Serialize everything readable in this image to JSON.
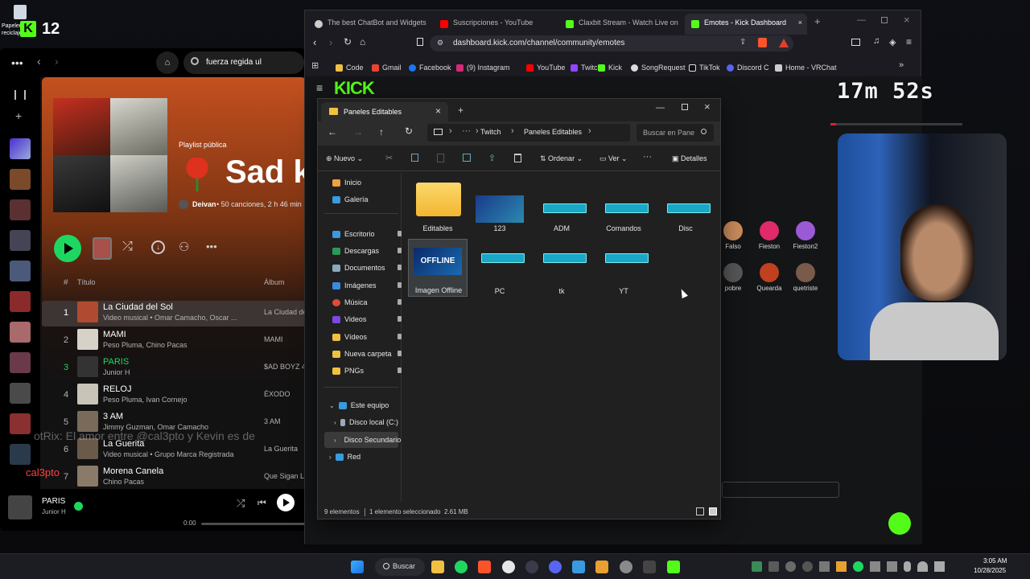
{
  "desktop": {
    "recycle_label": "Papelera de reciclaje",
    "kick_count": "12",
    "chat_bottom": "otRix: El amor entre @cal3pto y Kevin es de",
    "chat_user": "cal3pto"
  },
  "spotify": {
    "search_value": "fuerza regida ul",
    "playlist_type": "Playlist pública",
    "playlist_title": "Sad k",
    "owner": "Deivan",
    "meta": "• 50 canciones, 2 h 46 min",
    "col_title": "Título",
    "col_album": "Álbum",
    "tracks": [
      {
        "num": "1",
        "title": "La Ciudad del Sol",
        "sub": "Video musical • Omar Camacho, Oscar ...",
        "album": "La Ciudad de"
      },
      {
        "num": "2",
        "title": "MAMI",
        "sub": "Peso Pluma, Chino Pacas",
        "album": "MAMI"
      },
      {
        "num": "3",
        "title": "PARIS",
        "sub": "Junior H",
        "album": "$AD BOYZ 4"
      },
      {
        "num": "4",
        "title": "RELOJ",
        "sub": "Peso Pluma, Ivan Cornejo",
        "album": "ÉXODO"
      },
      {
        "num": "5",
        "title": "3 AM",
        "sub": "Jimmy Guzman, Omar Camacho",
        "album": "3 AM"
      },
      {
        "num": "6",
        "title": "La Guerita",
        "sub": "Video musical • Grupo Marca Registrada",
        "album": "La Guerita"
      },
      {
        "num": "7",
        "title": "Morena Canela",
        "sub": "Chino Pacas",
        "album": "Que Sigan Ll"
      }
    ],
    "now_playing_title": "PARIS",
    "now_playing_artist": "Junior H",
    "elapsed": "0:00"
  },
  "browser": {
    "tabs": [
      {
        "label": "The best ChatBot and Widgets"
      },
      {
        "label": "Suscripciones - YouTube"
      },
      {
        "label": "Claxbit Stream - Watch Live on"
      },
      {
        "label": "Emotes - Kick Dashboard"
      }
    ],
    "url": "dashboard.kick.com/channel/community/emotes",
    "bookmarks": [
      {
        "label": "Code"
      },
      {
        "label": "Gmail"
      },
      {
        "label": "Facebook"
      },
      {
        "label": "(9) Instagram"
      },
      {
        "label": "YouTube"
      },
      {
        "label": "Twitch"
      },
      {
        "label": "Kick"
      },
      {
        "label": "SongRequest"
      },
      {
        "label": "TikTok"
      },
      {
        "label": "Discord C"
      },
      {
        "label": "Home - VRChat"
      }
    ],
    "kick_logo": "KICK",
    "emotes": [
      {
        "label": "Falso"
      },
      {
        "label": "Fieston"
      },
      {
        "label": "Fieston2"
      },
      {
        "label": "pobre"
      },
      {
        "label": "Quearda"
      },
      {
        "label": "quetriste"
      }
    ]
  },
  "explorer": {
    "tab_title": "Paneles Editables",
    "crumbs": [
      "Twitch",
      "Paneles Editables"
    ],
    "search_placeholder": "Buscar en Pane",
    "toolbar": {
      "new": "Nuevo",
      "sort": "Ordenar",
      "view": "Ver",
      "details": "Detalles"
    },
    "nav_top": [
      {
        "label": "Inicio"
      },
      {
        "label": "Galería"
      }
    ],
    "nav_quick": [
      {
        "label": "Escritorio"
      },
      {
        "label": "Descargas"
      },
      {
        "label": "Documentos"
      },
      {
        "label": "Imágenes"
      },
      {
        "label": "Música"
      },
      {
        "label": "Videos"
      },
      {
        "label": "Vídeos"
      },
      {
        "label": "Nueva carpeta"
      },
      {
        "label": "PNGs"
      }
    ],
    "nav_pc": [
      {
        "label": "Este equipo"
      },
      {
        "label": "Disco local (C:)"
      },
      {
        "label": "Disco Secundario"
      },
      {
        "label": "Red"
      }
    ],
    "files": [
      {
        "label": "Editables"
      },
      {
        "label": "123"
      },
      {
        "label": "ADM"
      },
      {
        "label": "Comandos"
      },
      {
        "label": "Disc"
      },
      {
        "label": "Imagen Offline"
      },
      {
        "label": "PC"
      },
      {
        "label": "tk"
      },
      {
        "label": "YT"
      }
    ],
    "offline_text": "OFFLINE",
    "status_count": "9 elementos",
    "status_selected": "1 elemento seleccionado  2.61 MB"
  },
  "overlay": {
    "timer": "17m 52s"
  },
  "taskbar": {
    "search": "Buscar",
    "time": "3:05 AM",
    "date": "10/28/2025"
  },
  "colors": {
    "kick_green": "#53fc18",
    "spotify_green": "#1ed760",
    "accent_blue": "#0078d4"
  }
}
